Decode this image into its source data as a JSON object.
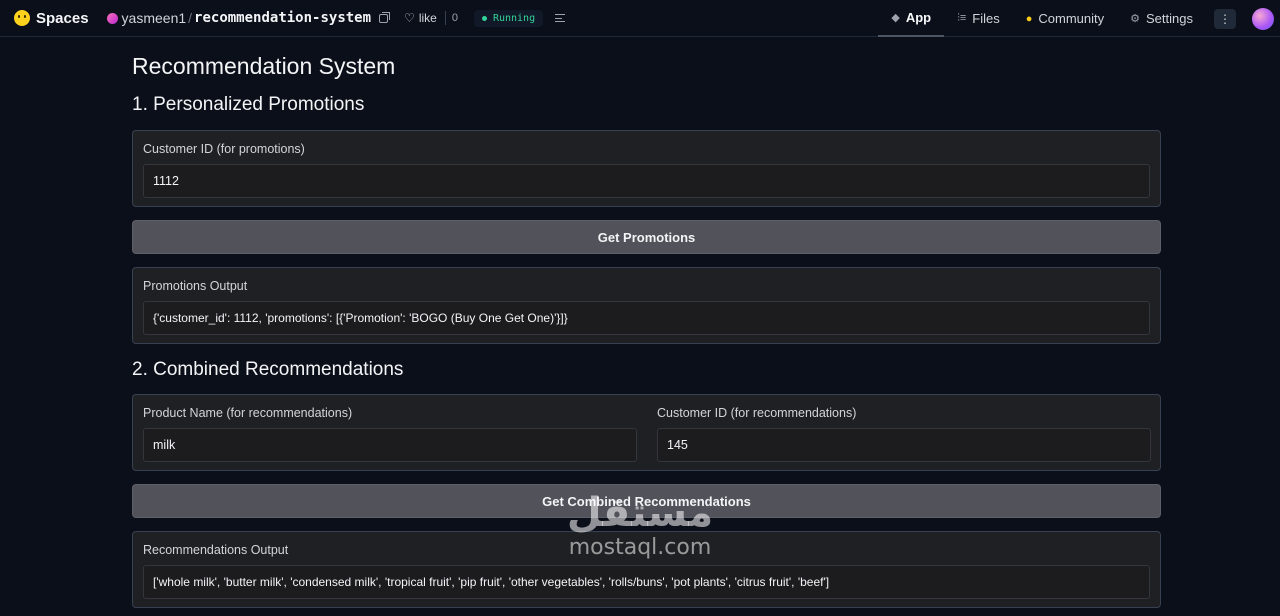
{
  "header": {
    "brand": "Spaces",
    "owner": "yasmeen1",
    "separator": "/",
    "repo": "recommendation-system",
    "like_label": "like",
    "like_count": "0",
    "status": "Running",
    "nav": [
      {
        "label": "App",
        "icon": "cube-icon"
      },
      {
        "label": "Files",
        "icon": "files-icon"
      },
      {
        "label": "Community",
        "icon": "community-icon"
      },
      {
        "label": "Settings",
        "icon": "gear-icon"
      }
    ],
    "more": "⋮"
  },
  "page": {
    "title": "Recommendation System",
    "section1": {
      "title": "1. Personalized Promotions",
      "customer_label": "Customer ID (for promotions)",
      "customer_value": "1112",
      "button": "Get Promotions",
      "output_label": "Promotions Output",
      "output_value": "{'customer_id': 1112, 'promotions': [{'Promotion': 'BOGO (Buy One Get One)'}]}"
    },
    "section2": {
      "title": "2. Combined Recommendations",
      "product_label": "Product Name (for recommendations)",
      "product_value": "milk",
      "customer_label": "Customer ID (for recommendations)",
      "customer_value": "145",
      "button": "Get Combined Recommendations",
      "output_label": "Recommendations Output",
      "output_value": "['whole milk', 'butter milk', 'condensed milk', 'tropical fruit', 'pip fruit', 'other vegetables', 'rolls/buns', 'pot plants', 'citrus fruit', 'beef']"
    }
  },
  "watermark": {
    "arabic": "مستقل",
    "latin": "mostaql.com"
  },
  "colors": {
    "background": "#0b0f19",
    "panel": "#1f2023",
    "button": "#52525b",
    "running": "#34d399"
  }
}
